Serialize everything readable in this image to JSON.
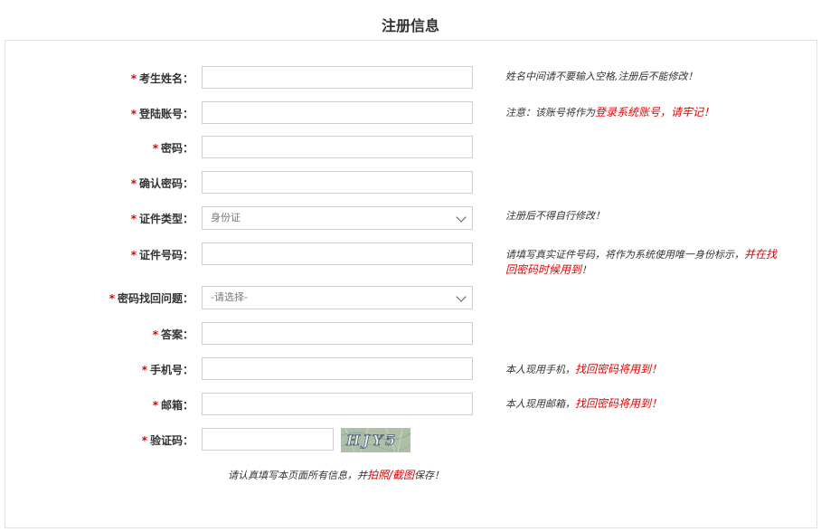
{
  "title": "注册信息",
  "required_mark": "*",
  "fields": {
    "name": {
      "label": "考生姓名：",
      "hint": "姓名中间请不要输入空格,注册后不能修改！"
    },
    "account": {
      "label": "登陆账号：",
      "hint_prefix": "注意：该账号将作为",
      "hint_red": "登录系统账号，请牢记",
      "hint_suffix": "！"
    },
    "password": {
      "label": "密码："
    },
    "confirm_password": {
      "label": "确认密码："
    },
    "id_type": {
      "label": "证件类型：",
      "selected": "身份证",
      "hint": "注册后不得自行修改！"
    },
    "id_number": {
      "label": "证件号码：",
      "hint_prefix": "请填写真实证件号码，将作为系统使用唯一身份标示，",
      "hint_red": "并在找回密码时候用到",
      "hint_suffix": "！"
    },
    "security_question": {
      "label": "密码找回问题：",
      "selected": "-请选择-"
    },
    "answer": {
      "label": "答案："
    },
    "phone": {
      "label": "手机号：",
      "hint_prefix": "本人现用手机，",
      "hint_red": "找回密码将用到！"
    },
    "email": {
      "label": "邮箱：",
      "hint_prefix": "本人现用邮箱，",
      "hint_red": "找回密码将用到！"
    },
    "captcha": {
      "label": "验证码：",
      "image_text": "HJY5"
    }
  },
  "footer": {
    "prefix": "请认真填写本页面所有信息，并",
    "red": "拍照/截图",
    "suffix": "保存！"
  },
  "colors": {
    "accent_red": "#e00000",
    "border": "#cfcfcf"
  }
}
